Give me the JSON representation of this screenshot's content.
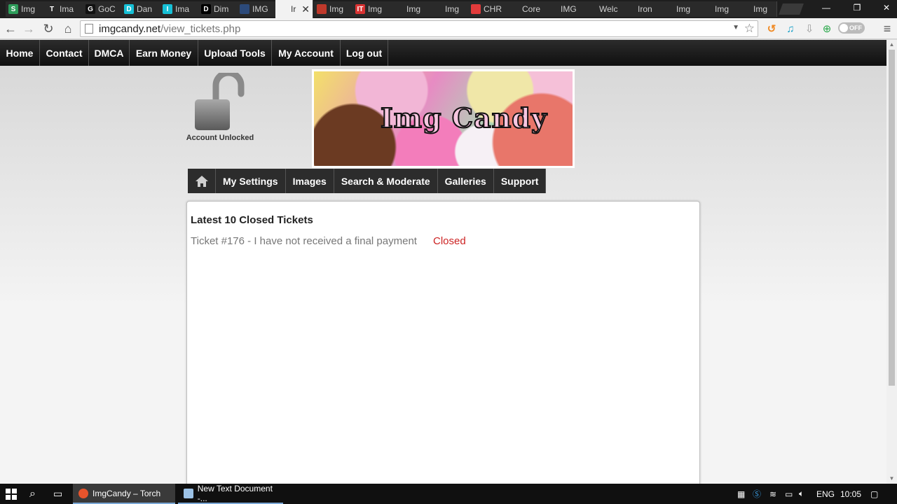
{
  "browser": {
    "tabs": [
      {
        "label": "Img",
        "fav_letter": "S",
        "fav_color": "#2e9e5b"
      },
      {
        "label": "Ima",
        "fav_letter": "T",
        "fav_color": "#2a2a2a"
      },
      {
        "label": "GoC",
        "fav_letter": "G",
        "fav_color": "#111111"
      },
      {
        "label": "Dan",
        "fav_letter": "D",
        "fav_color": "#16c0d6"
      },
      {
        "label": "Ima",
        "fav_letter": "I",
        "fav_color": "#16c0d6"
      },
      {
        "label": "Dim",
        "fav_letter": "D",
        "fav_color": "#000000"
      },
      {
        "label": "IMG",
        "fav_letter": "",
        "fav_color": "#2c4a7a"
      },
      {
        "label": "Ir",
        "fav_letter": "",
        "fav_color": "#f2f2f2"
      },
      {
        "label": "Img",
        "fav_letter": "",
        "fav_color": "#c0392b"
      },
      {
        "label": "Img",
        "fav_letter": "IT",
        "fav_color": "#d83232"
      },
      {
        "label": "Img",
        "fav_letter": "",
        "fav_color": "#2a2a2a"
      },
      {
        "label": "Img",
        "fav_letter": "",
        "fav_color": "#2a2a2a"
      },
      {
        "label": "CHR",
        "fav_letter": "",
        "fav_color": "#e23b3b"
      },
      {
        "label": "Core",
        "fav_letter": "",
        "fav_color": "#2a2a2a"
      },
      {
        "label": "IMG",
        "fav_letter": "",
        "fav_color": "#2a2a2a"
      },
      {
        "label": "Welc",
        "fav_letter": "",
        "fav_color": "#2a2a2a"
      },
      {
        "label": "Iron",
        "fav_letter": "",
        "fav_color": "#2a2a2a"
      },
      {
        "label": "Img",
        "fav_letter": "",
        "fav_color": "#2a2a2a"
      },
      {
        "label": "Img",
        "fav_letter": "",
        "fav_color": "#2a2a2a"
      },
      {
        "label": "Img",
        "fav_letter": "",
        "fav_color": "#2a2a2a"
      }
    ],
    "active_tab_index": 7,
    "tab_close": "✕",
    "url_host": "imgcandy.net",
    "url_path": "/view_tickets.php",
    "toggle_label": "OFF",
    "window_minimize": "—",
    "window_restore": "❐",
    "window_close": "✕"
  },
  "site": {
    "top_nav": [
      "Home",
      "Contact",
      "DMCA",
      "Earn Money",
      "Upload Tools",
      "My Account",
      "Log out"
    ],
    "lock_label": "Account Unlocked",
    "banner_text": "Img Candy",
    "sub_nav": [
      "My Settings",
      "Images",
      "Search & Moderate",
      "Galleries",
      "Support"
    ]
  },
  "tickets": {
    "title": "Latest 10 Closed Tickets",
    "items": [
      {
        "label": "Ticket #176 - I have not received a final payment",
        "status": "Closed"
      }
    ]
  },
  "taskbar": {
    "apps": [
      {
        "label": "ImgCandy – Torch",
        "active": true
      },
      {
        "label": "New Text Document -...",
        "active": false
      }
    ],
    "language": "ENG",
    "time": "10:05"
  },
  "colors": {
    "status_closed": "#cc2222",
    "nav_bg": "#2c2c2c"
  }
}
